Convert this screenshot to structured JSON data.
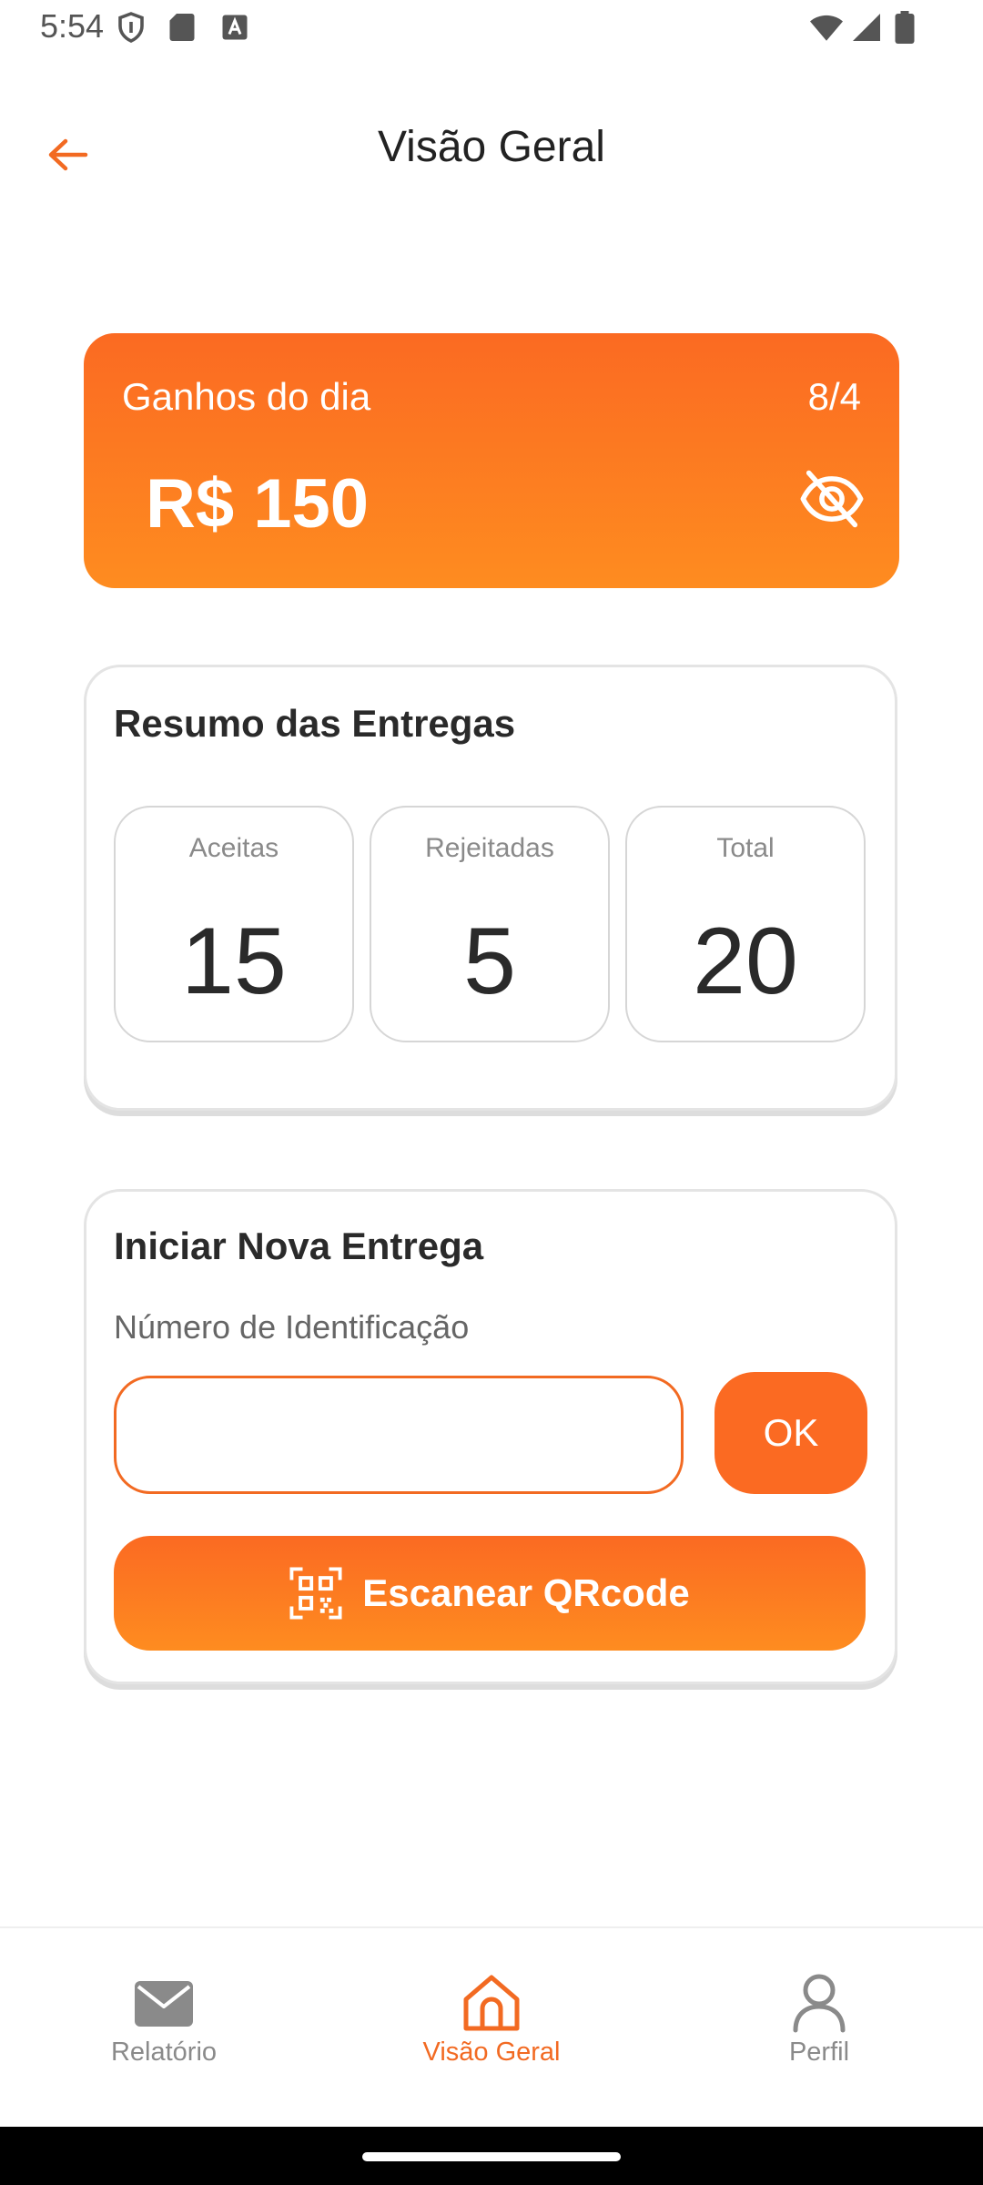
{
  "status_bar": {
    "time": "5:54",
    "icons": [
      "shield-icon",
      "sd-card-icon",
      "keyboard-a-icon",
      "wifi-icon",
      "signal-icon",
      "battery-icon"
    ]
  },
  "header": {
    "title": "Visão Geral",
    "back_icon": "arrow-left-icon"
  },
  "earnings": {
    "label": "Ganhos do dia",
    "date": "8/4",
    "value": "R$ 150",
    "visibility_icon": "eye-off-icon"
  },
  "summary": {
    "title": "Resumo das Entregas",
    "stats": [
      {
        "label": "Aceitas",
        "value": "15"
      },
      {
        "label": "Rejeitadas",
        "value": "5"
      },
      {
        "label": "Total",
        "value": "20"
      }
    ]
  },
  "new_delivery": {
    "title": "Iniciar Nova Entrega",
    "field_label": "Número de Identificação",
    "input_value": "",
    "ok_label": "OK",
    "scan_label": "Escanear QRcode",
    "scan_icon": "qr-scan-icon"
  },
  "nav": {
    "items": [
      {
        "label": "Relatório",
        "icon": "mail-icon",
        "active": false
      },
      {
        "label": "Visão Geral",
        "icon": "home-icon",
        "active": true
      },
      {
        "label": "Perfil",
        "icon": "user-icon",
        "active": false
      }
    ]
  },
  "colors": {
    "accent": "#fb6a22",
    "accent_light": "#fe8c20",
    "text_dark": "#2a2a2a",
    "text_muted": "#8a8a8a"
  }
}
